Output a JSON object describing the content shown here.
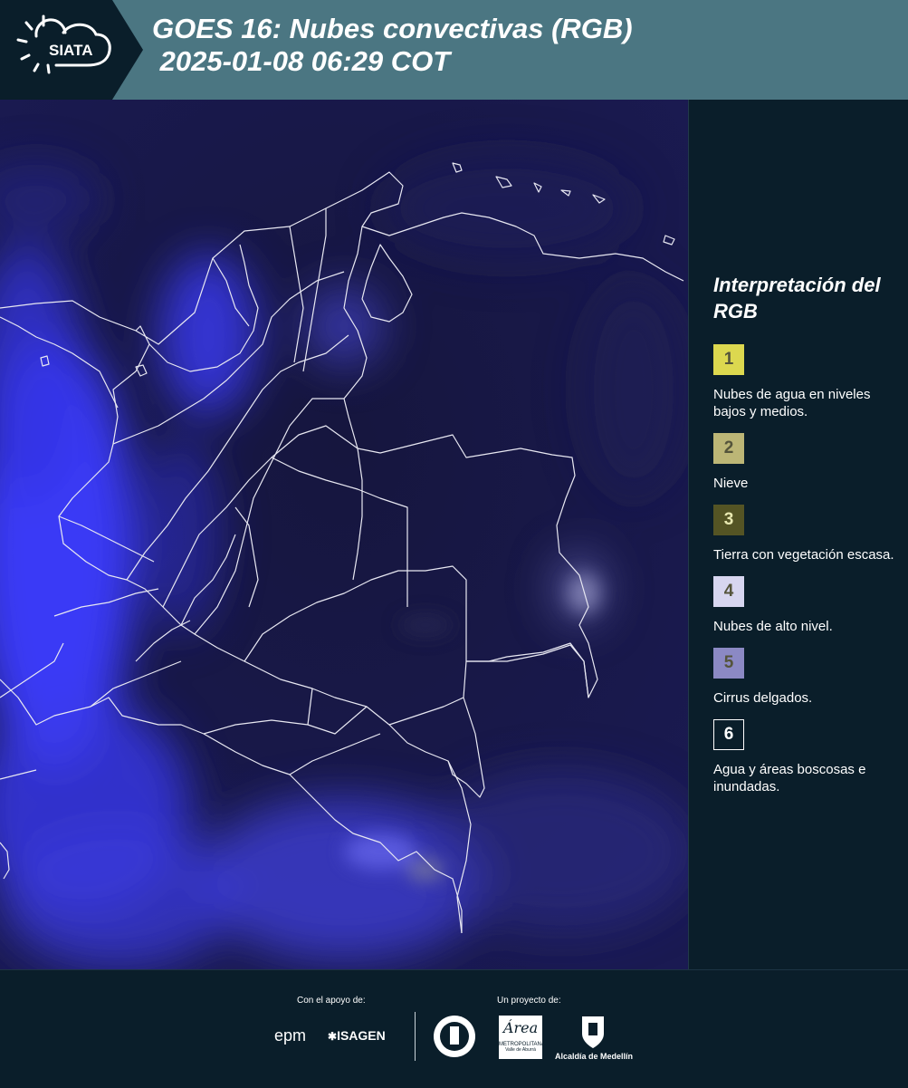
{
  "header": {
    "logo_text": "SIATA",
    "title": "GOES 16: Nubes convectivas (RGB)\n 2025-01-08 06:29 COT"
  },
  "legend": {
    "title": "Interpretación del RGB",
    "items": [
      {
        "number": "1",
        "label": "Nubes de agua en niveles bajos y medios.",
        "color": "#dcd84f"
      },
      {
        "number": "2",
        "label": "Nieve",
        "color": "#bcb676"
      },
      {
        "number": "3",
        "label": "Tierra con vegetación escasa.",
        "color": "#545424"
      },
      {
        "number": "4",
        "label": "Nubes de alto nivel.",
        "color": "#d7d6f0"
      },
      {
        "number": "5",
        "label": "Cirrus delgados.",
        "color": "#8b89c4"
      },
      {
        "number": "6",
        "label": "Agua y áreas boscosas e inundadas.",
        "color": "#0a1e2a"
      }
    ]
  },
  "footer": {
    "support_label": "Con el apoyo de:",
    "project_label": "Un proyecto de:",
    "logos": {
      "epm": "epm",
      "isagen": "ISAGEN",
      "area_script": "Área",
      "area_line1": "METROPOLITANA",
      "area_line2": "Valle de Aburrá",
      "alcaldia": "Alcaldía de Medellín"
    }
  },
  "colors": {
    "header_bg": "#4b7682",
    "page_bg": "#0a1e2a",
    "map_bg": "#14143d",
    "cloud_blue": "#3c3cff"
  }
}
